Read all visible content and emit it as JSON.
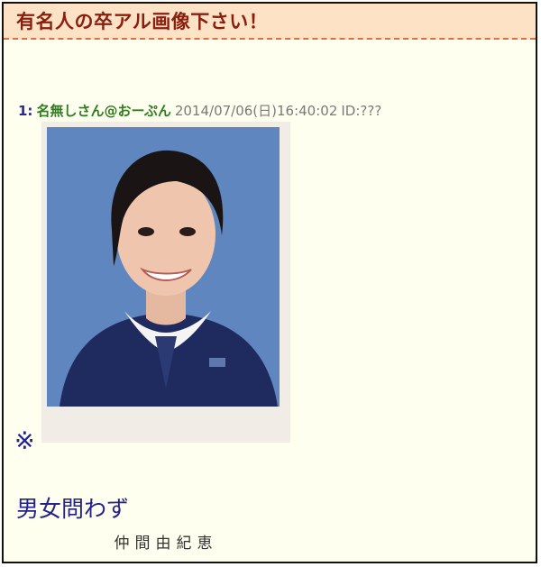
{
  "thread": {
    "title": "有名人の卒アル画像下さい！"
  },
  "post": {
    "number": "1:",
    "name": "名無しさん@おーぷん",
    "date": "2014/07/06(日)16:40:02",
    "id": "ID:???"
  },
  "photo": {
    "caption": "仲間由紀恵",
    "icon": "yearbook-portrait-photo"
  },
  "body": {
    "mark": "※",
    "text": "男女問わず"
  },
  "colors": {
    "header_bg": "#fde2c6",
    "title": "#8b1e0f",
    "name": "#2f7d1f",
    "body_text": "#22228a",
    "page_bg": "#fffff0"
  }
}
